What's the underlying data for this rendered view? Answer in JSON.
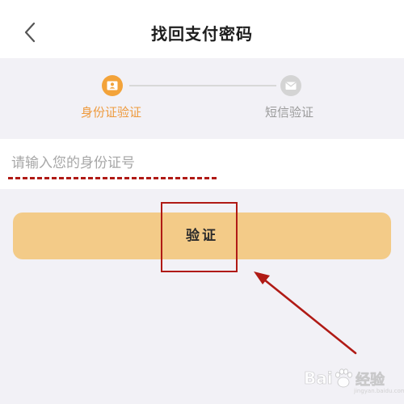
{
  "header": {
    "title": "找回支付密码",
    "back_icon": "chevron-left-icon"
  },
  "steps": [
    {
      "label": "身份证验证",
      "icon": "id-card-icon",
      "state": "active",
      "color": "#f3a33a"
    },
    {
      "label": "短信验证",
      "icon": "envelope-icon",
      "state": "inactive",
      "color": "#d4d4d4"
    }
  ],
  "form": {
    "id_placeholder": "请输入您的身份证号",
    "id_value": ""
  },
  "verify_button": {
    "label": "验证",
    "color": "#f3cb88"
  },
  "annotation": {
    "color": "#b01a15"
  },
  "watermark": {
    "brand_left": "Bai",
    "brand_right": "经验",
    "url": "jingyan.baidu.com"
  },
  "colors": {
    "accent": "#ee9a3d",
    "background": "#f2f1f6"
  }
}
